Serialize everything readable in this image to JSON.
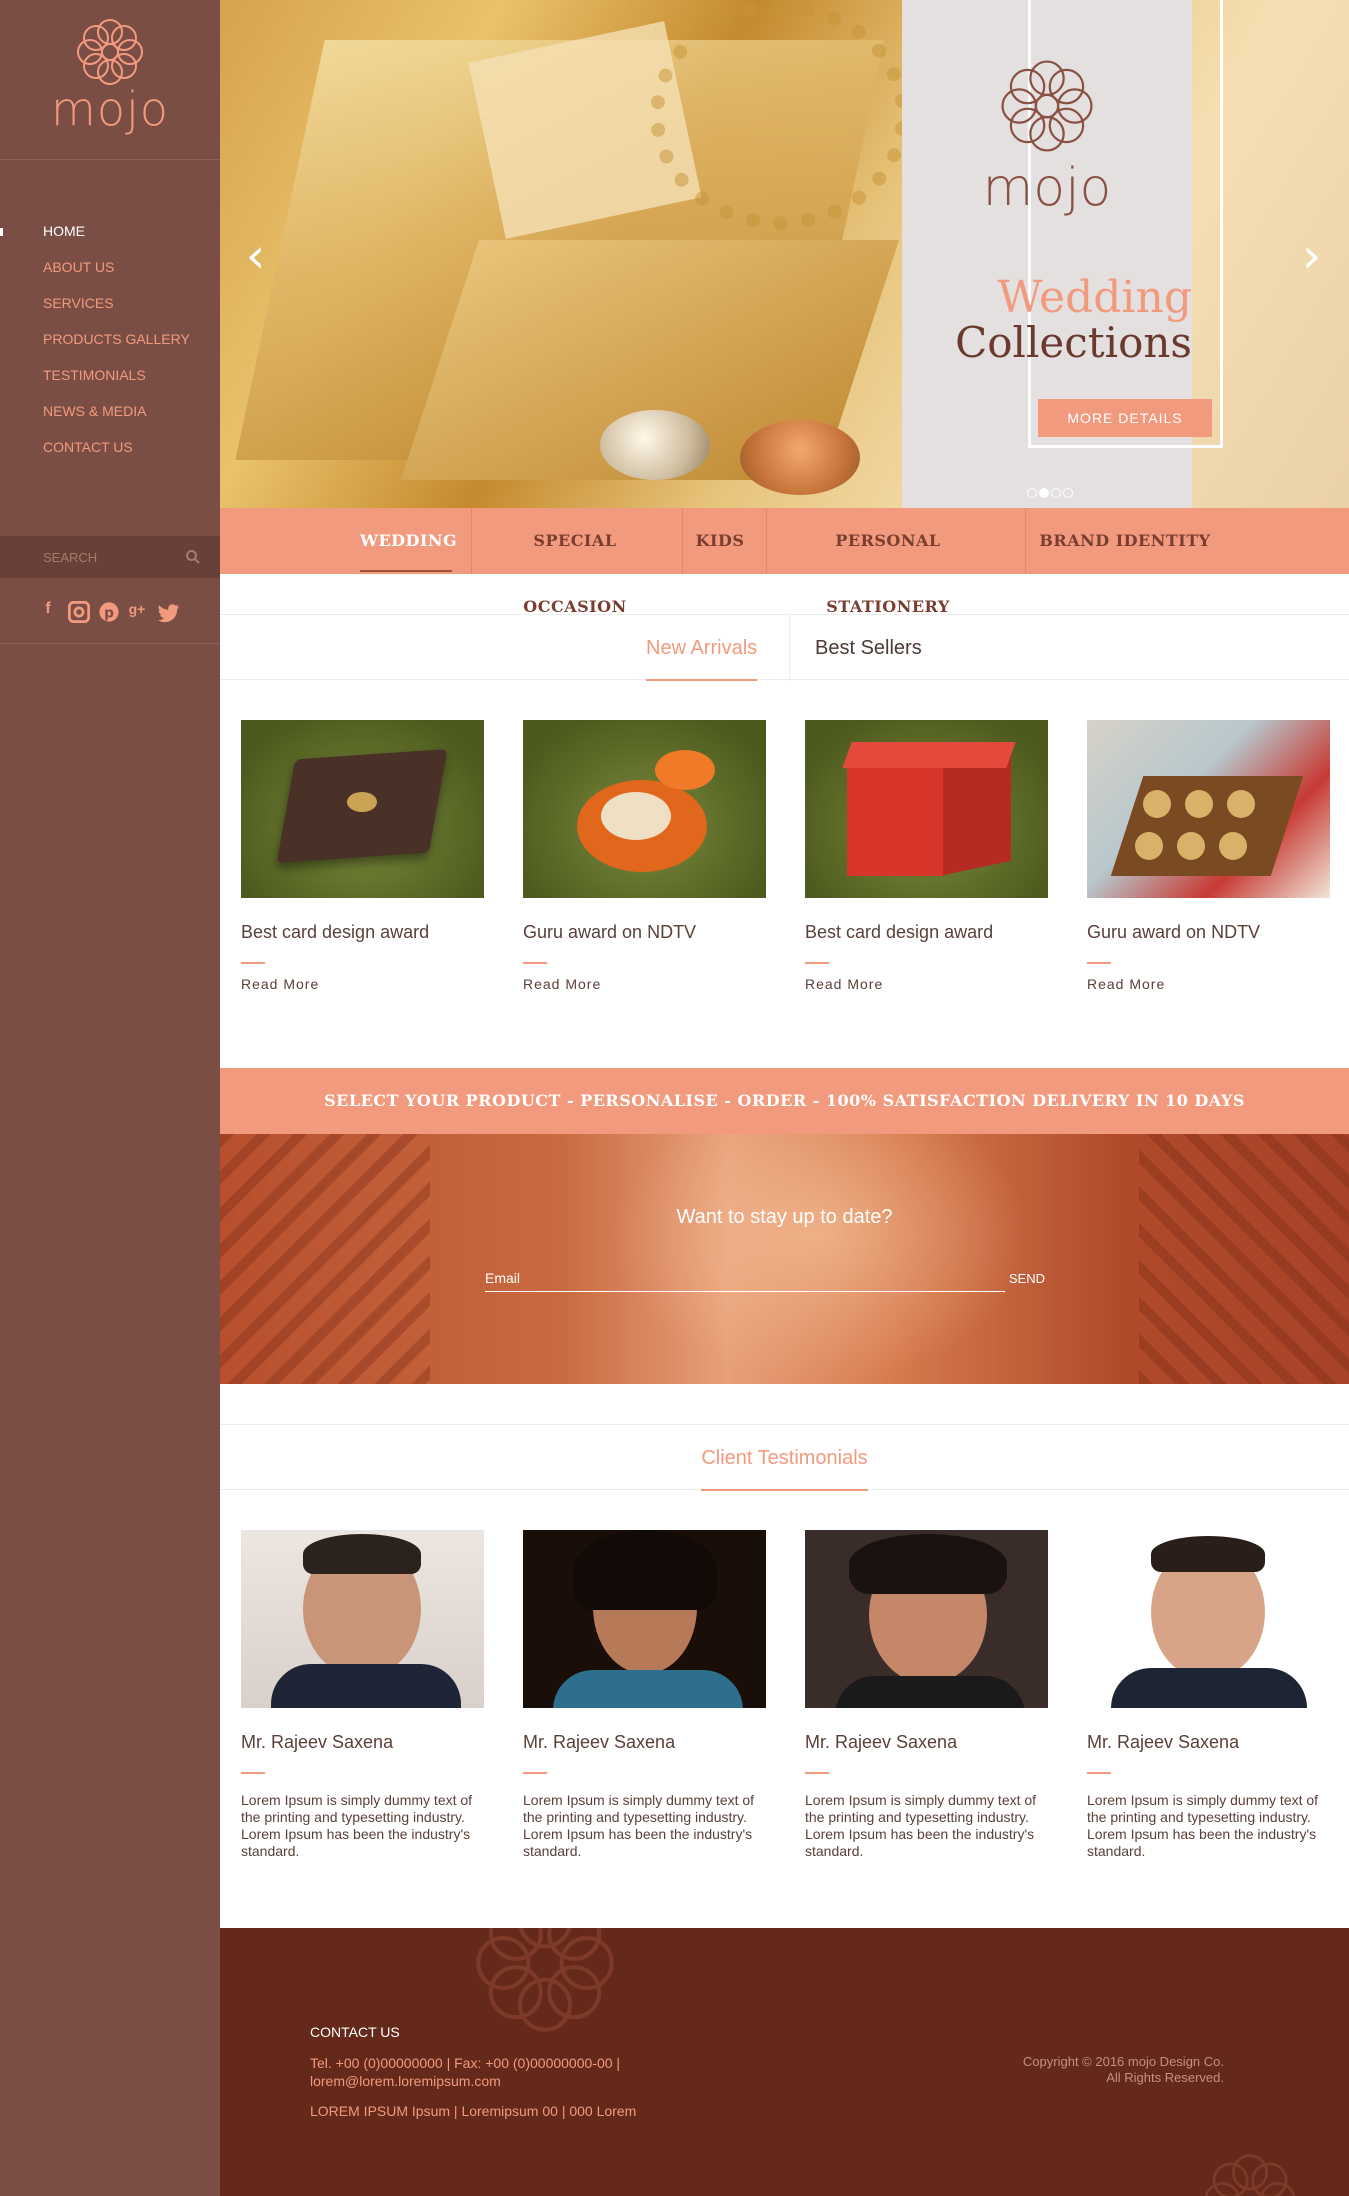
{
  "brand": {
    "name": "mojo",
    "accent": "#f29a7e",
    "sidebar_bg": "#7a4e45",
    "footer_bg": "#64291a"
  },
  "nav": {
    "items": [
      {
        "label": "HOME",
        "active": true
      },
      {
        "label": "ABOUT US"
      },
      {
        "label": "SERVICES"
      },
      {
        "label": "PRODUCTS GALLERY"
      },
      {
        "label": "TESTIMONIALS"
      },
      {
        "label": "NEWS & MEDIA"
      },
      {
        "label": "CONTACT US"
      }
    ]
  },
  "search": {
    "placeholder": "SEARCH",
    "icon": "search-icon"
  },
  "social": [
    "f",
    "in-icon",
    "p",
    "g+",
    "t"
  ],
  "hero": {
    "logo_text": "mojo",
    "title_line1": "Wedding",
    "title_line2": "Collections",
    "button": "MORE DETAILS",
    "slide_count": 4,
    "active_slide": 1
  },
  "categories": [
    "WEDDING",
    "SPECIAL OCCASION",
    "KIDS",
    "PERSONAL STATIONERY",
    "BRAND IDENTITY"
  ],
  "tabs": [
    "New Arrivals",
    "Best Sellers"
  ],
  "products": [
    {
      "name": "Best card design award",
      "link": "Read More"
    },
    {
      "name": "Guru award on NDTV",
      "link": "Read More"
    },
    {
      "name": "Best card design award",
      "link": "Read More"
    },
    {
      "name": "Guru award on NDTV",
      "link": "Read More"
    }
  ],
  "strip": "SELECT YOUR PRODUCT - PERSONALISE - ORDER - 100% SATISFACTION DELIVERY IN 10 DAYS",
  "newsletter": {
    "heading": "Want to stay up to date?",
    "placeholder": "Email",
    "button": "SEND"
  },
  "testimonials": {
    "title": "Client Testimonials",
    "items": [
      {
        "name": "Mr. Rajeev Saxena",
        "text": "Lorem Ipsum is simply dummy text of the printing and typesetting industry. Lorem Ipsum has been the industry's standard."
      },
      {
        "name": "Mr. Rajeev Saxena",
        "text": "Lorem Ipsum is simply dummy text of the printing and typesetting industry. Lorem Ipsum has been the industry's standard."
      },
      {
        "name": "Mr. Rajeev Saxena",
        "text": "Lorem Ipsum is simply dummy text of the printing and typesetting industry. Lorem Ipsum has been the industry's standard."
      },
      {
        "name": "Mr. Rajeev Saxena",
        "text": "Lorem Ipsum is simply dummy text of the printing and typesetting industry. Lorem Ipsum has been the industry's standard."
      }
    ]
  },
  "footer": {
    "heading": "CONTACT US",
    "line1": "Tel. +00 (0)00000000   |   Fax: +00 (0)00000000-00   |",
    "line2": "lorem@lorem.loremipsum.com",
    "line3": "LOREM IPSUM Ipsum   |   Loremipsum 00   |   000 Lorem",
    "copyright1": "Copyright © 2016 mojo Design Co.",
    "copyright2": "All Rights Reserved."
  }
}
